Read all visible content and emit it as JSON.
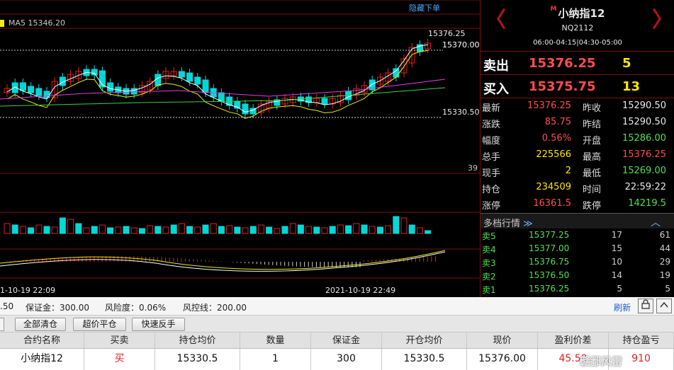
{
  "chart": {
    "ma_label": "MA5 15346.20",
    "hide_order_link": "隐藏下单",
    "price_high_label": "15376.25",
    "price_line_label": "15370.00",
    "price_low_label": "15330.50",
    "right_number": "39",
    "time_label_1": "1-10-19 22:09",
    "time_label_2": "2021-10-19 22:49",
    "colors": {
      "up": "#e02020",
      "down": "#00d8d8",
      "ma5": "#ffffff",
      "ma10": "#f0f000",
      "ma20": "#e040e0",
      "ma60": "#40d040"
    }
  },
  "header": {
    "prev_arrow": "〈",
    "next_arrow": "〉",
    "m_badge": "M",
    "name": "小纳指12",
    "code": "NQ2112",
    "hours": "06:00-04:15|04:30-05:00"
  },
  "orderbook": {
    "sell_label": "卖出",
    "sell_price": "15376.25",
    "sell_qty": "5",
    "buy_label": "买入",
    "buy_price": "15375.75",
    "buy_qty": "13"
  },
  "quote": [
    {
      "l1": "最新",
      "v1": "15376.25",
      "c1": "#ff4d4d",
      "l2": "昨收",
      "v2": "15290.50",
      "c2": "#e8e8e8"
    },
    {
      "l1": "涨跌",
      "v1": "85.75",
      "c1": "#ff4d4d",
      "l2": "昨结",
      "v2": "15290.50",
      "c2": "#e8e8e8"
    },
    {
      "l1": "幅度",
      "v1": "0.56%",
      "c1": "#ff4d4d",
      "l2": "开盘",
      "v2": "15286.00",
      "c2": "#4ee04e"
    },
    {
      "l1": "总手",
      "v1": "225566",
      "c1": "#ffe600",
      "l2": "最高",
      "v2": "15376.25",
      "c2": "#ff4d4d"
    },
    {
      "l1": "现手",
      "v1": "2",
      "c1": "#ffe600",
      "l2": "最低",
      "v2": "15269.00",
      "c2": "#4ee04e"
    },
    {
      "l1": "持仓",
      "v1": "234509",
      "c1": "#ffe600",
      "l2": "时间",
      "v2": "22:59:22",
      "c2": "#e8e8e8"
    },
    {
      "l1": "涨停",
      "v1": "16361.5",
      "c1": "#ff4d4d",
      "l2": "跌停",
      "v2": "14219.5",
      "c2": "#4ee04e"
    }
  ],
  "depth": {
    "title": "多档行情",
    "expand_icon": "≫",
    "collapse_icon": "︿",
    "rows": [
      {
        "label": "卖5",
        "price": "15377.25",
        "qty": "17",
        "qty2": "61"
      },
      {
        "label": "卖4",
        "price": "15377.00",
        "qty": "15",
        "qty2": "44"
      },
      {
        "label": "卖3",
        "price": "15376.75",
        "qty": "10",
        "qty2": "29"
      },
      {
        "label": "卖2",
        "price": "15376.50",
        "qty": "14",
        "qty2": "19"
      },
      {
        "label": "卖1",
        "price": "15376.25",
        "qty": "5",
        "qty2": "5"
      }
    ]
  },
  "account": {
    "left_frag": ".50",
    "margin": "保证金：300.00",
    "risk": "风险度：0.06%",
    "control": "风控线：200.00",
    "refresh": "刷新"
  },
  "buttons": {
    "close_all": "全部清仓",
    "super_close": "超价平仓",
    "reverse": "快速反手"
  },
  "table": {
    "headers": [
      "合约名称",
      "买卖",
      "持仓均价",
      "数量",
      "保证金",
      "开仓均价",
      "现价",
      "盈利价差",
      "持仓盈亏"
    ],
    "row": [
      "小纳指12",
      "买",
      "15330.5",
      "1",
      "300",
      "15330.5",
      "15376.00",
      "45.50",
      "910"
    ],
    "watermark": "赣鄱风雷"
  }
}
